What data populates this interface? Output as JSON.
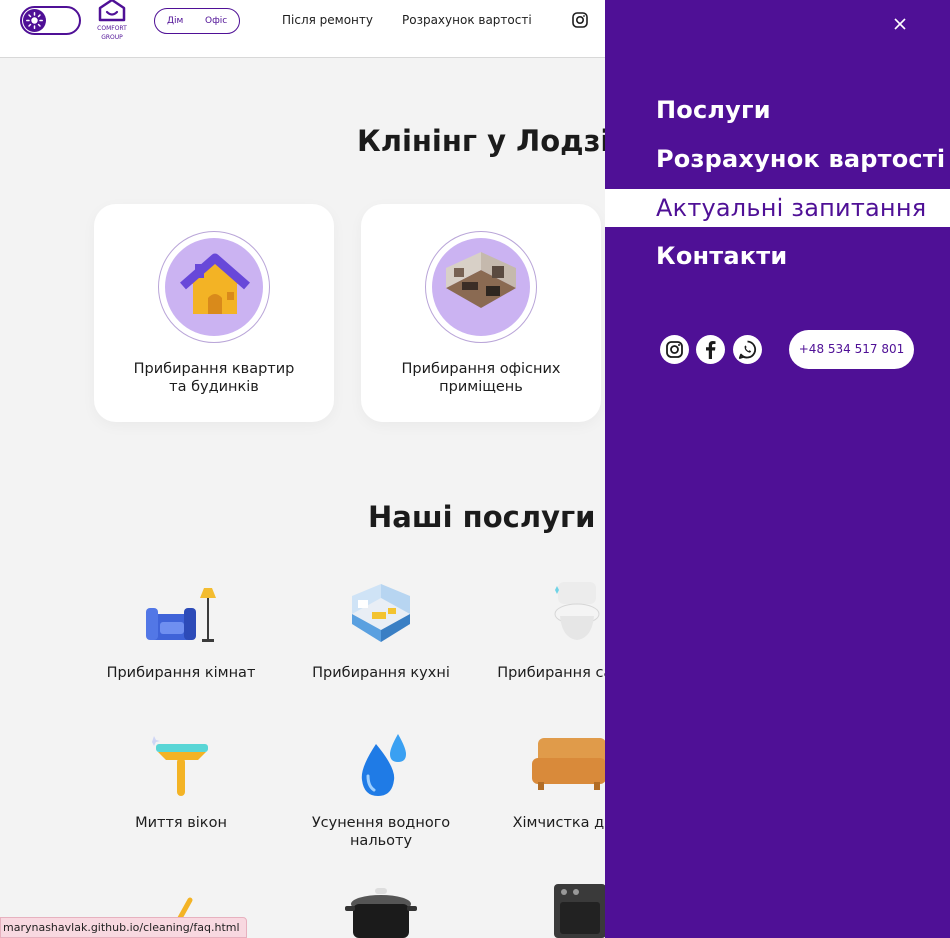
{
  "header": {
    "logo_line1": "COMFORT",
    "logo_line2": "GROUP",
    "segment": {
      "option1": "Дім",
      "option2": "Офіс"
    },
    "nav": [
      "Після ремонту",
      "Розрахунок вартості"
    ]
  },
  "main": {
    "hero_title": "Клінінг у Лодзі",
    "cards": [
      {
        "label": "Прибирання квартир та будинків"
      },
      {
        "label": "Прибирання офісних приміщень"
      }
    ],
    "services_title": "Наші послуги",
    "services": [
      {
        "label": "Прибирання кімнат",
        "icon": "sofa-lamp-icon"
      },
      {
        "label": "Прибирання кухні",
        "icon": "kitchen-icon"
      },
      {
        "label": "Прибирання санвузла",
        "icon": "toilet-icon"
      },
      {
        "label": "Миття вікон",
        "icon": "window-squeegee-icon"
      },
      {
        "label": "Усунення водного нальоту",
        "icon": "water-drops-icon"
      },
      {
        "label": "Хімчистка дивана",
        "icon": "couch-icon"
      }
    ]
  },
  "side_menu": {
    "items": [
      "Послуги",
      "Розрахунок вартості",
      "Актуальні запитання",
      "Контакти"
    ],
    "active_index": 2,
    "phone": "+48 534 517 801",
    "socials": [
      "instagram-icon",
      "facebook-icon",
      "whatsapp-icon"
    ]
  },
  "statusbar": {
    "url": "marynashavlak.github.io/cleaning/faq.html"
  },
  "colors": {
    "accent": "#4f1096",
    "background": "#f3f3f3",
    "card": "#ffffff",
    "statusbar": "#f8d8e0"
  }
}
